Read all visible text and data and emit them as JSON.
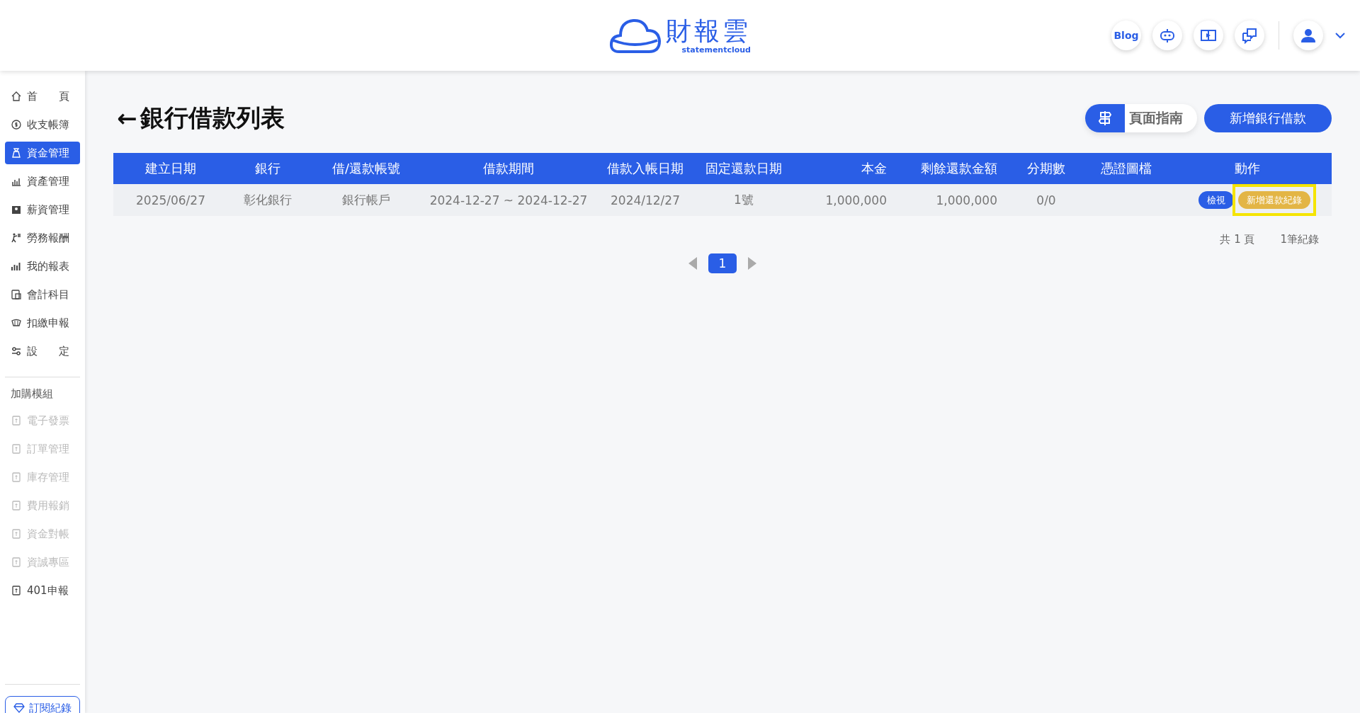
{
  "header": {
    "logo_title": "財報雲",
    "logo_subtitle": "statementcloud",
    "blog_label": "Blog"
  },
  "sidebar": {
    "items": [
      {
        "label": "首　　頁",
        "selected": false,
        "disabled": false
      },
      {
        "label": "收支帳簿",
        "selected": false,
        "disabled": false
      },
      {
        "label": "資金管理",
        "selected": true,
        "disabled": false
      },
      {
        "label": "資產管理",
        "selected": false,
        "disabled": false
      },
      {
        "label": "薪資管理",
        "selected": false,
        "disabled": false
      },
      {
        "label": "勞務報酬",
        "selected": false,
        "disabled": false
      },
      {
        "label": "我的報表",
        "selected": false,
        "disabled": false
      },
      {
        "label": "會計科目",
        "selected": false,
        "disabled": false
      },
      {
        "label": "扣繳申報",
        "selected": false,
        "disabled": false
      },
      {
        "label": "設　　定",
        "selected": false,
        "disabled": false
      }
    ],
    "addon_heading": "加購模組",
    "addons": [
      {
        "label": "電子發票",
        "disabled": true
      },
      {
        "label": "訂單管理",
        "disabled": true
      },
      {
        "label": "庫存管理",
        "disabled": true
      },
      {
        "label": "費用報銷",
        "disabled": true
      },
      {
        "label": "資金對帳",
        "disabled": true
      },
      {
        "label": "資誠專區",
        "disabled": true
      },
      {
        "label": "401申報",
        "disabled": false
      }
    ],
    "subscription_button": "訂閱紀錄"
  },
  "page": {
    "back_arrow": "←",
    "title": "銀行借款列表",
    "guide_button": "頁面指南",
    "add_button": "新增銀行借款"
  },
  "table": {
    "columns": [
      "建立日期",
      "銀行",
      "借/還款帳號",
      "借款期間",
      "借款入帳日期",
      "固定還款日期",
      "本金",
      "剩餘還款金額",
      "分期數",
      "憑證圖檔",
      "動作"
    ],
    "rows": [
      {
        "cells": [
          "2025/06/27",
          "彰化銀行",
          "銀行帳戶",
          "2024-12-27 ~ 2024-12-27",
          "2024/12/27",
          "1號",
          "1,000,000",
          "1,000,000",
          "0/0",
          ""
        ],
        "actions": [
          {
            "label": "檢視",
            "kind": "primary",
            "highlighted": false
          },
          {
            "label": "新增還款紀錄",
            "kind": "warning",
            "highlighted": true
          }
        ]
      }
    ]
  },
  "summary": {
    "pages": "共 1 頁",
    "records": "1筆紀錄"
  },
  "pagination": {
    "pages": [
      {
        "label": "1",
        "selected": true
      }
    ]
  }
}
